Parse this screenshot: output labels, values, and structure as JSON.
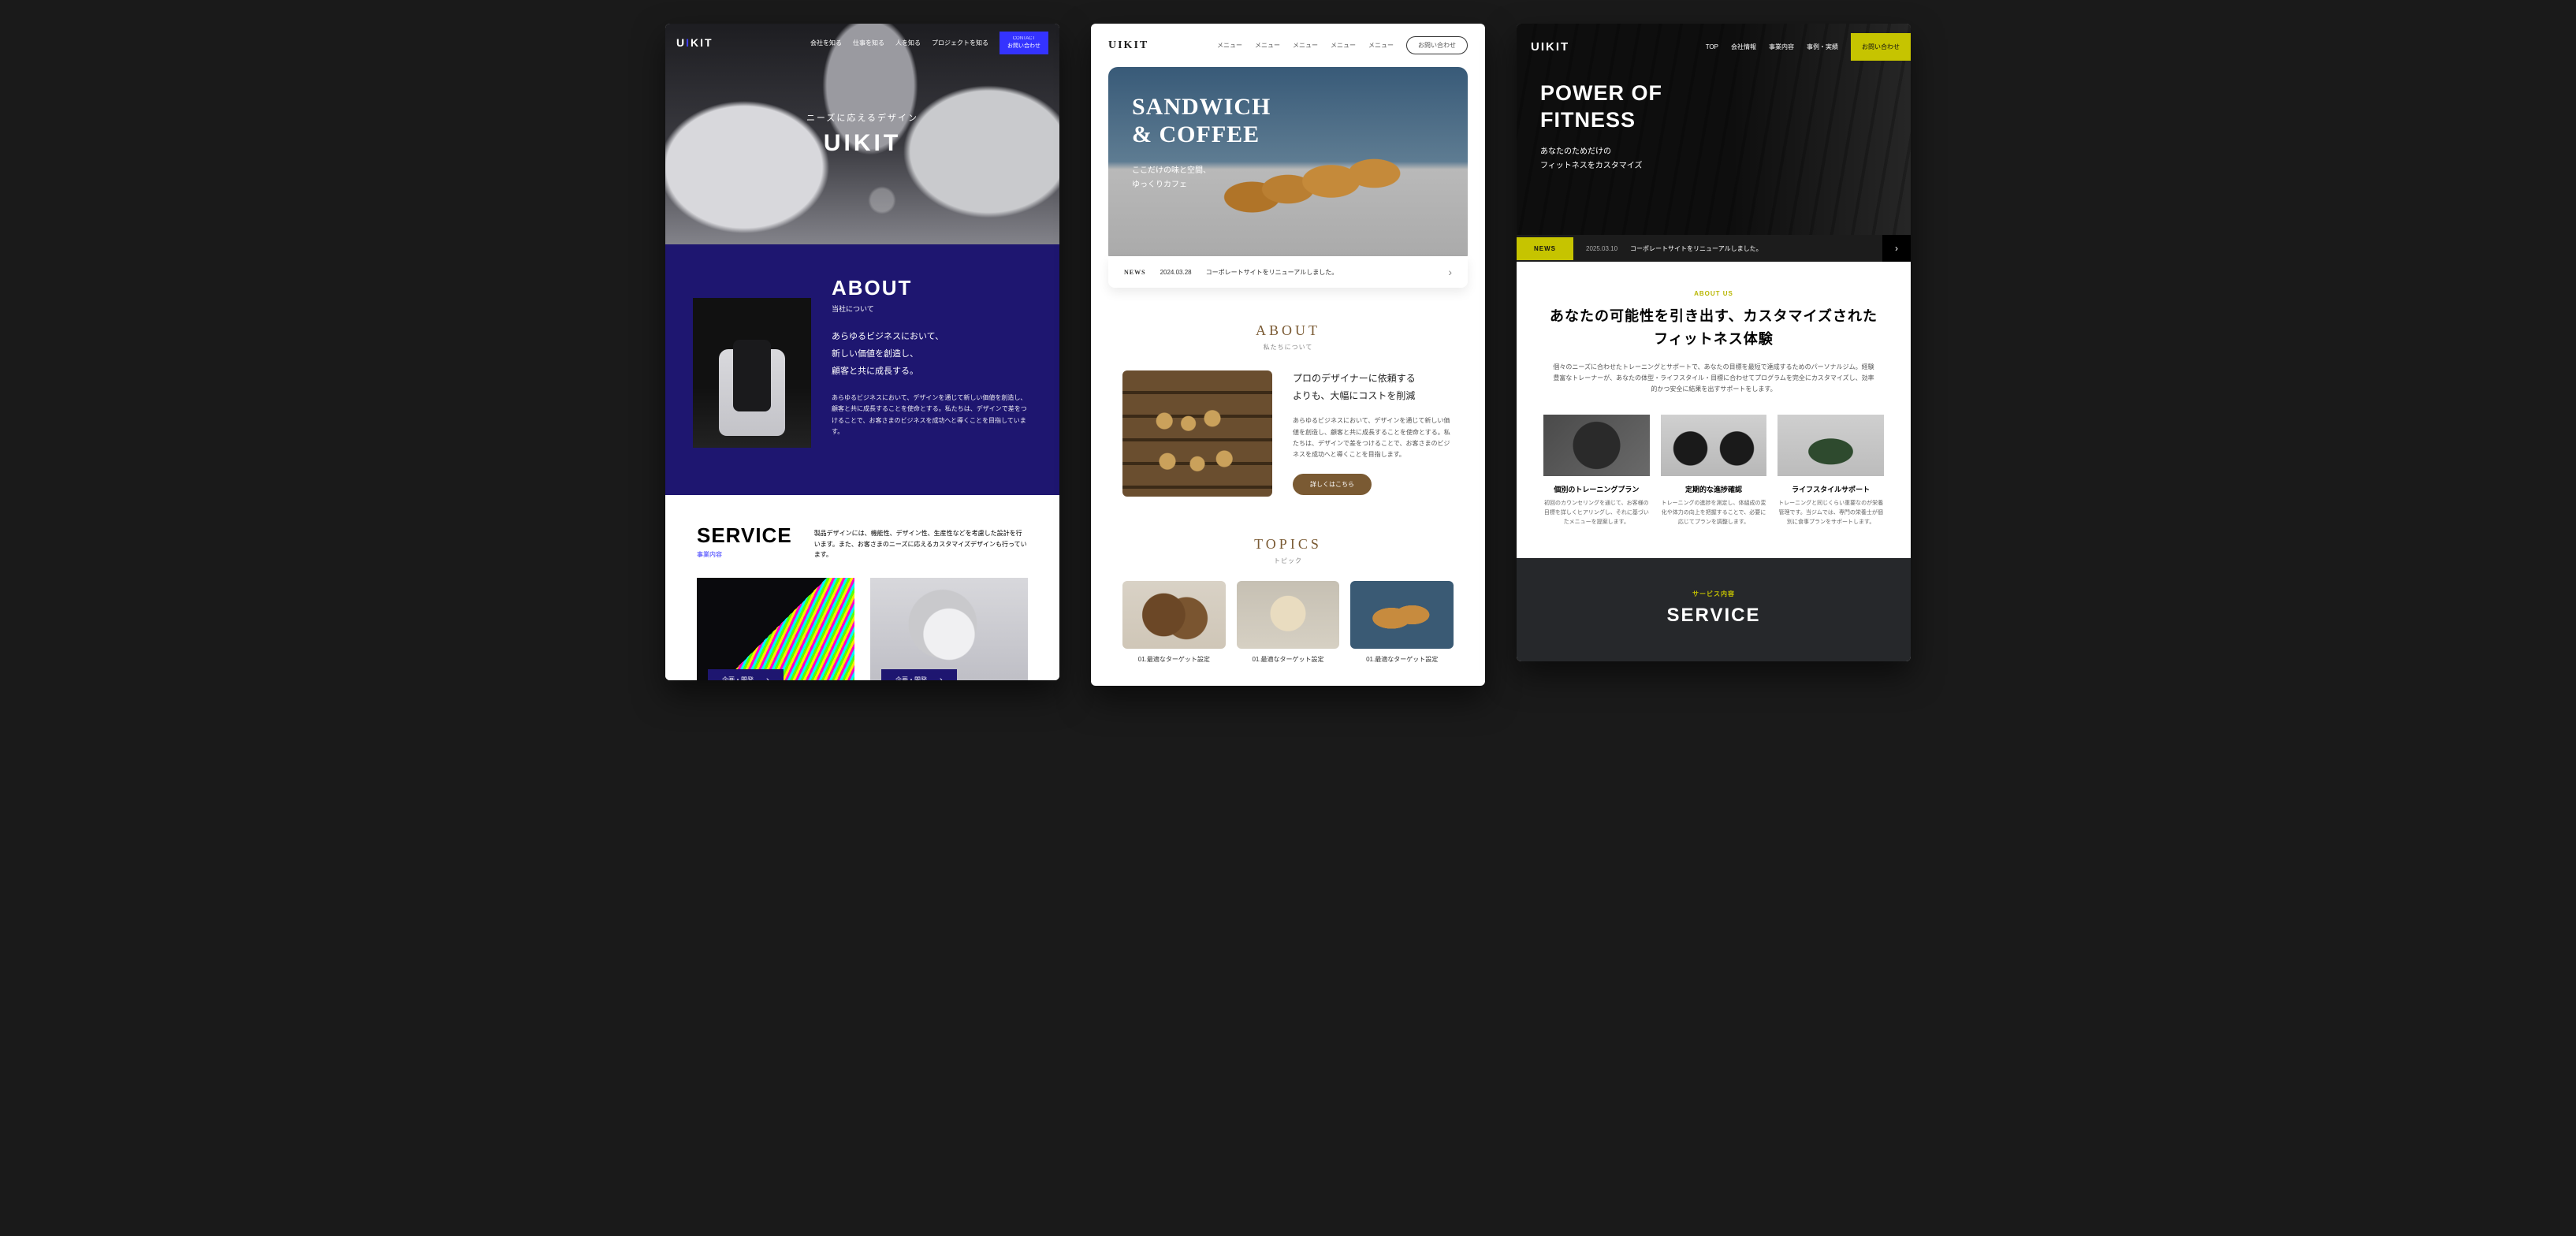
{
  "card1": {
    "logo": {
      "pre": "U",
      "accent": "I",
      "post": "KIT"
    },
    "nav": [
      "会社を知る",
      "仕事を知る",
      "人を知る",
      "プロジェクトを知る"
    ],
    "contact": {
      "en": "CONTACT",
      "jp": "お問い合わせ"
    },
    "hero": {
      "sub": "ニーズに応えるデザイン",
      "title": "UIKIT"
    },
    "about": {
      "h": "ABOUT",
      "jp": "当社について",
      "lead": "あらゆるビジネスにおいて、\n新しい価値を創造し、\n顧客と共に成長する。",
      "body": "あらゆるビジネスにおいて、デザインを通じて新しい価値を創造し、顧客と共に成長することを使命とする。私たちは、デザインで差をつけることで、お客さまのビジネスを成功へと導くことを目指しています。"
    },
    "service": {
      "h": "SERVICE",
      "jp": "事業内容",
      "lead": "製品デザインには、機能性、デザイン性、生産性などを考慮した設計を行います。また、お客さまのニーズに応えるカスタマイズデザインも行っています。",
      "items": [
        {
          "label": "企画・開発"
        },
        {
          "label": "企画・開発"
        }
      ]
    }
  },
  "card2": {
    "logo": "UIKIT",
    "nav": [
      "メニュー",
      "メニュー",
      "メニュー",
      "メニュー",
      "メニュー"
    ],
    "contact": "お問い合わせ",
    "hero": {
      "h1": "SANDWICH",
      "h2": "& COFFEE",
      "sub1": "ここだけの味と空間、",
      "sub2": "ゆっくりカフェ"
    },
    "news": {
      "label": "NEWS",
      "date": "2024.03.28",
      "text": "コーポレートサイトをリニューアルしました。"
    },
    "about": {
      "h": "ABOUT",
      "jp": "私たちについて",
      "lead": "プロのデザイナーに依頼する\nよりも、大幅にコストを削減",
      "body": "あらゆるビジネスにおいて、デザインを通じて新しい価値を創造し、顧客と共に成長することを使命とする。私たちは、デザインで差をつけることで、お客さまのビジネスを成功へと導くことを目指します。",
      "btn": "詳しくはこちら"
    },
    "topics": {
      "h": "TOPICS",
      "jp": "トピック",
      "items": [
        {
          "title": "01.最適なターゲット設定"
        },
        {
          "title": "01.最適なターゲット設定"
        },
        {
          "title": "01.最適なターゲット設定"
        }
      ]
    }
  },
  "card3": {
    "logo": "UIKIT",
    "nav": [
      "TOP",
      "会社情報",
      "事業内容",
      "事例・実績"
    ],
    "contact": "お問い合わせ",
    "hero": {
      "h1": "POWER OF",
      "h2": "FITNESS",
      "sub1": "あなたのためだけの",
      "sub2": "フィットネスをカスタマイズ"
    },
    "news": {
      "label": "NEWS",
      "date": "2025.03.10",
      "text": "コーポレートサイトをリニューアルしました。"
    },
    "about": {
      "en": "ABOUT US",
      "h": "あなたの可能性を引き出す、カスタマイズされたフィットネス体験",
      "body": "個々のニーズに合わせたトレーニングとサポートで、あなたの目標を最短で達成するためのパーソナルジム。経験豊富なトレーナーが、あなたの体型・ライフスタイル・目標に合わせてプログラムを完全にカスタマイズし、効率的かつ安全に結果を出すサポートをします。"
    },
    "features": [
      {
        "h": "個別のトレーニングプラン",
        "body": "初回のカウンセリングを通じて、お客様の目標を詳しくヒアリングし、それに基づいたメニューを提案します。"
      },
      {
        "h": "定期的な進捗確認",
        "body": "トレーニングの進捗を測定し、体組成の変化や体力の向上を把握することで、必要に応じてプランを調整します。"
      },
      {
        "h": "ライフスタイルサポート",
        "body": "トレーニングと同じくらい重要なのが栄養管理です。当ジムでは、専門の栄養士が個別に食事プランをサポートします。"
      }
    ],
    "service": {
      "en": "サービス内容",
      "h": "SERVICE"
    }
  }
}
